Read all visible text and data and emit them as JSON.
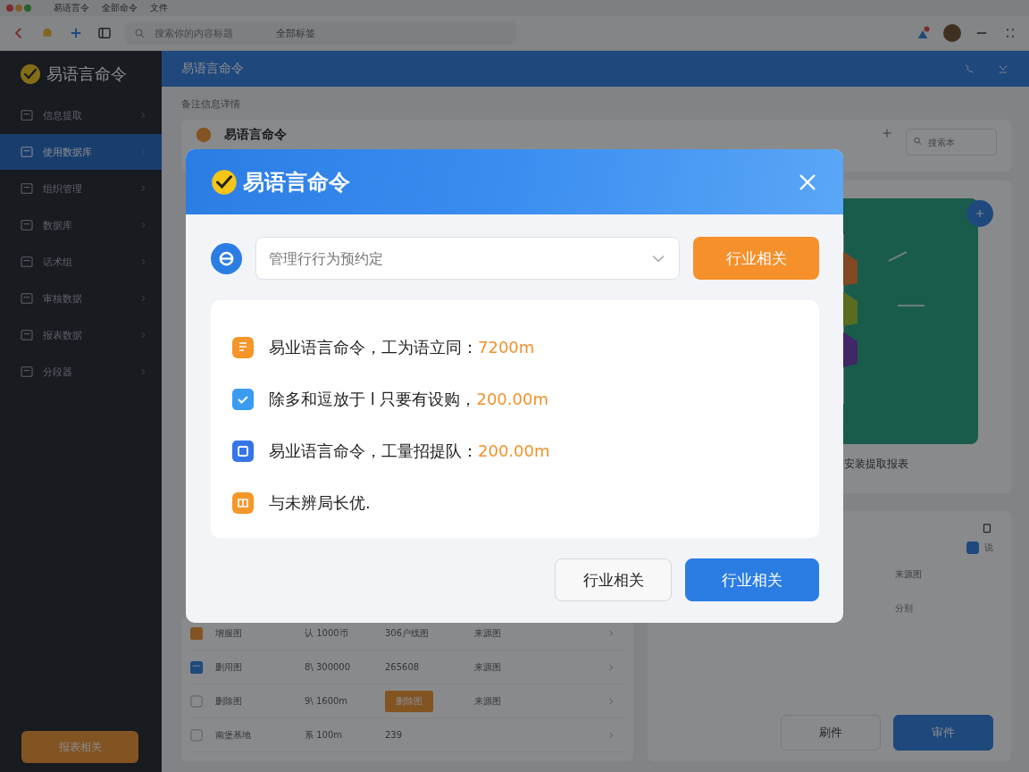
{
  "menu_bar": {
    "items": [
      "易语言令",
      "全部命令",
      "文件"
    ]
  },
  "toolbar": {
    "search": {
      "placeholder": "搜索你的内容标题"
    },
    "tag": "全部标签",
    "notification": true
  },
  "sidebar": {
    "title": "易语言命令",
    "items": [
      {
        "label": "信息提取",
        "selected": false
      },
      {
        "label": "使用数据库",
        "selected": true
      },
      {
        "label": "组织管理",
        "selected": false
      },
      {
        "label": "数据库",
        "selected": false
      },
      {
        "label": "话术组",
        "selected": false
      },
      {
        "label": "审核数据",
        "selected": false
      },
      {
        "label": "报表数据",
        "selected": false
      },
      {
        "label": "分段器",
        "selected": false
      }
    ],
    "button": "报表相关"
  },
  "header": {
    "title": "易语言命令"
  },
  "breadcrumb": "备注信息详情",
  "card": {
    "title": "易语言命令",
    "search": {
      "placeholder": "搜索本"
    }
  },
  "table": {
    "rows": [
      {
        "kind": "orange",
        "name": "增服图",
        "code": "认 1000币",
        "value": "306户线图",
        "badge": false,
        "status": "来源图"
      },
      {
        "kind": "blue",
        "name": "删用图",
        "code": "8\\ 300000",
        "value": "265608",
        "badge": false,
        "status": "来源图"
      },
      {
        "kind": "outline",
        "name": "删除图",
        "code": "9\\ 1600m",
        "value": "删除图",
        "badge": true,
        "status": "来源图"
      },
      {
        "kind": "outline",
        "name": "南堡基地",
        "code": "系 100m",
        "value": "239",
        "badge": false
      }
    ]
  },
  "preview": {
    "caption": "安装提取报表"
  },
  "panel": {
    "checkbox": {
      "label": "说",
      "checked": true
    },
    "rows": [
      "来源图",
      "分别"
    ],
    "buttons": [
      {
        "label": "刷件",
        "primary": false
      },
      {
        "label": "审件",
        "primary": true
      }
    ]
  },
  "dialog": {
    "title": "易语言命令",
    "select": {
      "placeholder": "管理行行为预约定"
    },
    "action": "行业相关",
    "items": [
      {
        "kind": "doc",
        "text": "易业语言命令，工为语立同：",
        "value": "7200m"
      },
      {
        "kind": "check",
        "text": "除多和逗放于 l 只要有设购，",
        "value": "200.00m"
      },
      {
        "kind": "square",
        "text": "易业语言命令，工量招提队：",
        "value": "200.00m"
      },
      {
        "kind": "note",
        "text": "与未辨局长优."
      }
    ],
    "buttons": [
      {
        "label": "行业相关",
        "primary": false
      },
      {
        "label": "行业相关",
        "primary": true
      }
    ]
  }
}
